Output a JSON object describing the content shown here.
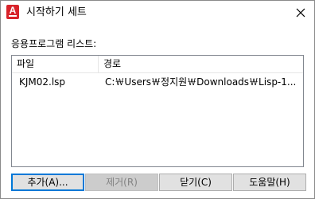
{
  "window": {
    "title": "시작하기 세트",
    "icon": "autocad-a-icon",
    "icon_letter": "A",
    "close_symbol": "✕"
  },
  "list": {
    "label": "응용프로그램 리스트:",
    "columns": [
      "파일",
      "경로"
    ],
    "rows": [
      {
        "file": "KJM02.lsp",
        "path": "C:￦Users￦정지원￦Downloads￦Lisp-1..."
      }
    ]
  },
  "buttons": {
    "add": "추가(A)...",
    "remove": "제거(R)",
    "close": "닫기(C)",
    "help": "도움말(H)"
  },
  "colors": {
    "accent": "#0078d7",
    "icon_red": "#d8232a",
    "disabled_text": "#838383"
  }
}
